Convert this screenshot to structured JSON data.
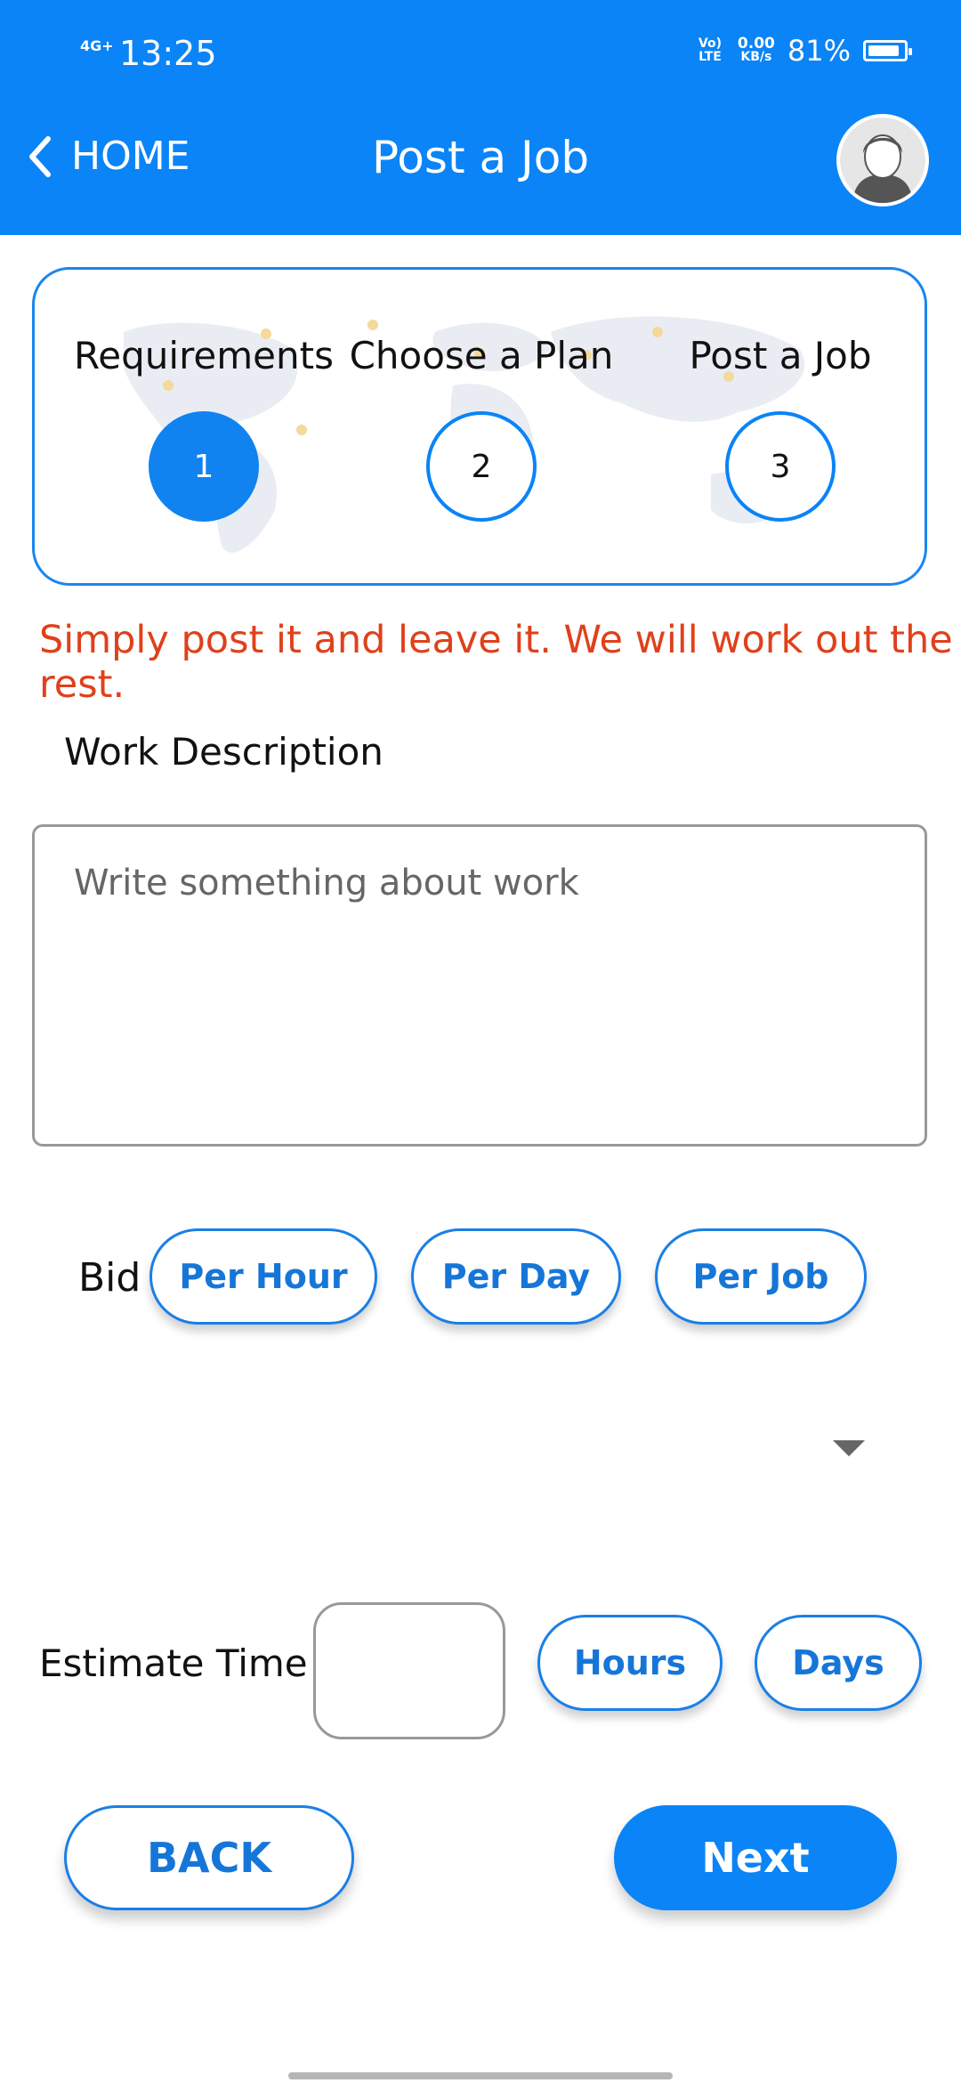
{
  "status_bar": {
    "network": "4G+",
    "time": "13:25",
    "volte": "Vo) LTE",
    "speed_value": "0.00",
    "speed_unit": "KB/s",
    "battery": "81%",
    "battery_level": 0.81
  },
  "header": {
    "back_label": "HOME",
    "title": "Post a Job",
    "accent_color": "#0a84f7"
  },
  "stepper": {
    "steps": [
      {
        "label": "Requirements",
        "number": "1",
        "active": true
      },
      {
        "label": "Choose a Plan",
        "number": "2",
        "active": false
      },
      {
        "label": "Post a Job",
        "number": "3",
        "active": false
      }
    ]
  },
  "tagline": "Simply post it and leave it. We will work out the rest.",
  "work_description": {
    "label": "Work Description",
    "placeholder": "Write something about work",
    "value": ""
  },
  "bid": {
    "label": "Bid",
    "options": [
      "Per Hour",
      "Per Day",
      "Per Job"
    ]
  },
  "estimate": {
    "label": "Estimate Time",
    "value": "",
    "units": [
      "Hours",
      "Days"
    ]
  },
  "actions": {
    "back": "BACK",
    "next": "Next"
  },
  "icons": {
    "back": "chevron-left-icon",
    "avatar": "user-avatar-icon",
    "dropdown": "dropdown-arrow-icon",
    "map": "world-map-icon"
  }
}
